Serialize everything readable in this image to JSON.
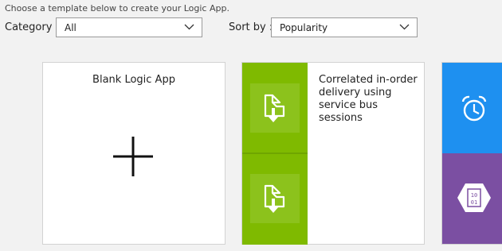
{
  "intro": "Choose a template below to create your Logic App.",
  "filters": {
    "category_label": "Category :",
    "category_value": "All",
    "sort_label": "Sort by :",
    "sort_value": "Popularity"
  },
  "templates": [
    {
      "title": "Blank Logic App",
      "icon": "plus-icon"
    },
    {
      "title": "Correlated in-order delivery using service bus sessions",
      "icons": [
        "document-download-icon",
        "document-download-icon"
      ],
      "colors": [
        "#7fba00",
        "#8cc21c"
      ]
    },
    {
      "title": "",
      "icons": [
        "alarm-clock-icon",
        "binary-hexagon-icon"
      ],
      "colors": [
        "#1e90f0",
        "#7b4fa2"
      ]
    }
  ]
}
